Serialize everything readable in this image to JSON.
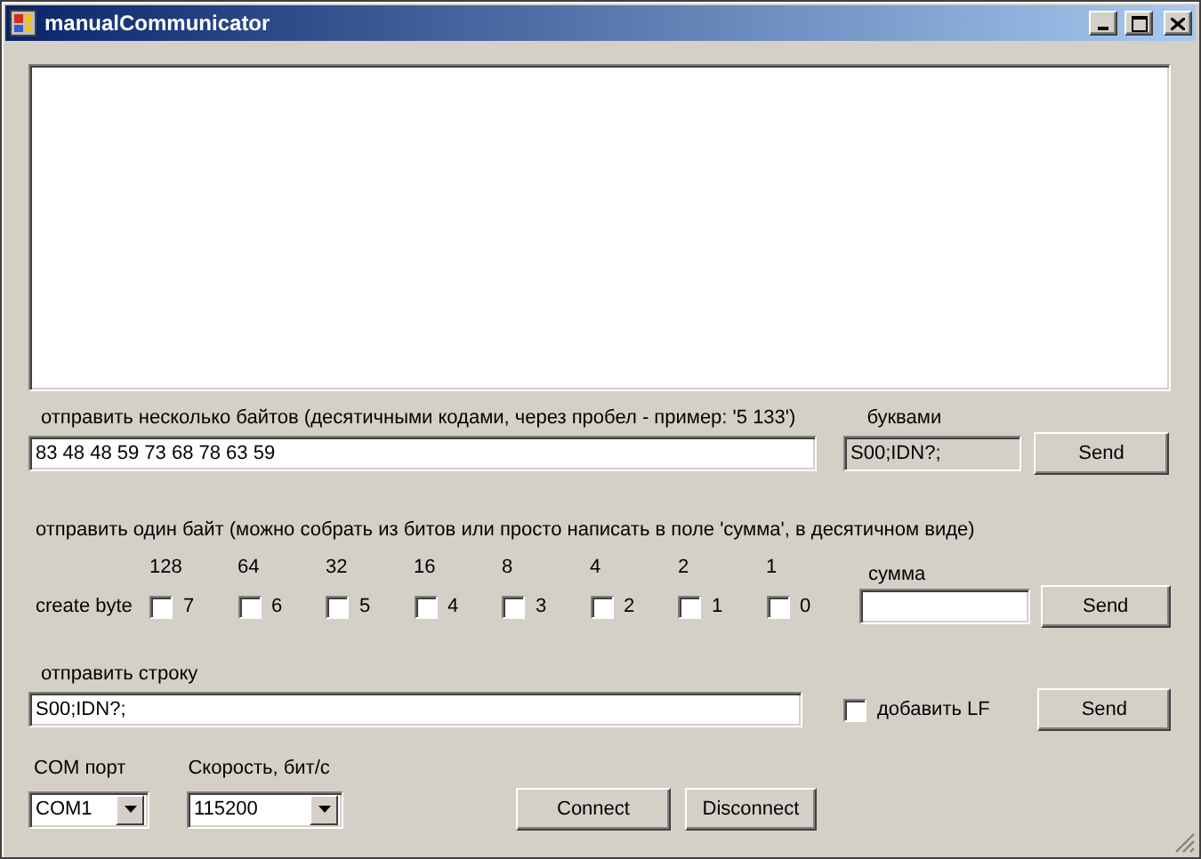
{
  "window": {
    "title": "manualCommunicator"
  },
  "bytes_section": {
    "label": "отправить несколько байтов (десятичными кодами, через пробел - пример: '5 133')",
    "letters_label": "буквами",
    "value": "83 48 48 59 73 68 78 63 59",
    "letters_value": "S00;IDN?;",
    "button": "Send"
  },
  "byte_section": {
    "label": "отправить один байт (можно собрать из битов или просто написать в поле 'сумма', в десятичном виде)",
    "row_label": "create byte",
    "sum_label": "сумма",
    "button": "Send",
    "bits": [
      {
        "weight": "128",
        "index": "7",
        "checked": false
      },
      {
        "weight": "64",
        "index": "6",
        "checked": false
      },
      {
        "weight": "32",
        "index": "5",
        "checked": false
      },
      {
        "weight": "16",
        "index": "4",
        "checked": false
      },
      {
        "weight": "8",
        "index": "3",
        "checked": false
      },
      {
        "weight": "4",
        "index": "2",
        "checked": false
      },
      {
        "weight": "2",
        "index": "1",
        "checked": false
      },
      {
        "weight": "1",
        "index": "0",
        "checked": false
      }
    ]
  },
  "string_section": {
    "label": "отправить строку",
    "value": "S00;IDN?;",
    "add_lf": {
      "label": "добавить LF",
      "checked": false
    },
    "button": "Send"
  },
  "connection": {
    "port_label": "COM порт",
    "port": "COM1",
    "speed_label": "Скорость, бит/с",
    "speed": "115200",
    "buttons": [
      "Connect",
      "Disconnect"
    ]
  }
}
